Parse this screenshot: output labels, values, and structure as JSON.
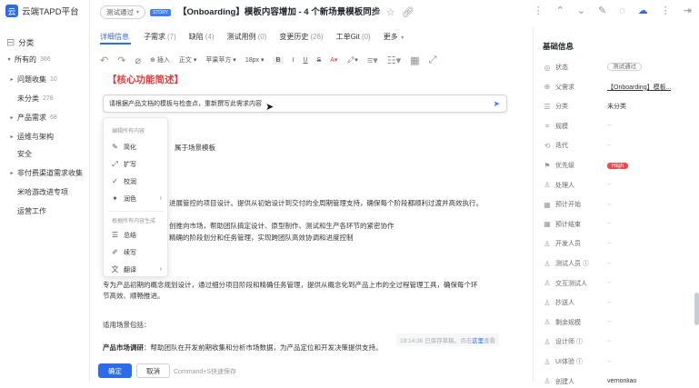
{
  "app": {
    "logo_char": "云",
    "name": "云端TAPD平台"
  },
  "sidebar": {
    "category_title": "分类",
    "items": [
      {
        "label": "所有的",
        "count": "366",
        "arrow": "▾"
      },
      {
        "label": "问题收集",
        "count": "10",
        "arrow": "▸"
      },
      {
        "label": "未分类",
        "count": "278",
        "arrow": ""
      },
      {
        "label": "产品需求",
        "count": "68",
        "arrow": "▸"
      },
      {
        "label": "运维与架构",
        "count": "",
        "arrow": "▸"
      },
      {
        "label": "安全",
        "count": "",
        "arrow": ""
      },
      {
        "label": "非付费渠道需求收集",
        "count": "",
        "arrow": "▸"
      },
      {
        "label": "米哈游改进专项",
        "count": "",
        "arrow": ""
      },
      {
        "label": "运营工作",
        "count": "",
        "arrow": ""
      }
    ]
  },
  "header": {
    "status": "测试通过",
    "badge": "STORY",
    "title": "【Onboarding】模板内容增加 - 4 个新场景模板同步"
  },
  "tabs": [
    {
      "label": "详细信息",
      "count": ""
    },
    {
      "label": "子需求",
      "count": "(7)"
    },
    {
      "label": "缺陷",
      "count": "(4)"
    },
    {
      "label": "测试用例",
      "count": "(0)"
    },
    {
      "label": "变更历史",
      "count": "(26)"
    },
    {
      "label": "工单Git",
      "count": "(0)"
    },
    {
      "label": "更多",
      "count": ""
    }
  ],
  "toolbar": {
    "insert": "插入",
    "text_style": "正文",
    "font": "苹果苹方",
    "size": "18px"
  },
  "editor": {
    "section_heading": "【核心功能简述】",
    "ai_prompt": "请根据产品文档的模板与检查点，重新撰写此需求内容",
    "line1": "属于场景模板",
    "line2": "进展管控的项目设计。提供从初始设计到交付的全周期管理支持，确保每个阶段都顺利过渡并高效执行。",
    "line3": "创推向市场，帮助团队搞定设计、原型制作、测试和生产各环节的紧密协作",
    "line4": "精确的阶段划分和任务管理，实现跨团队高效协调和进度控制",
    "line5": "专为产品初期的概念规划设计，通过细分项目阶段和精确任务管理，提供从概念化到产品上市的全过程管理工具，确保每个环",
    "line6": "节高效、顺畅推进。",
    "line7": "适用场景包括：",
    "line8_bold": "产品市场调研",
    "line8": "：帮助团队在开发前期收集和分析市场数据，为产品定位和开发决策提供支持。"
  },
  "ai_menu": {
    "group1": "编辑所有内容",
    "group2": "根据所有内容生成",
    "items1": [
      {
        "icon": "✎",
        "label": "简化",
        "sub": false
      },
      {
        "icon": "⤢",
        "label": "扩写",
        "sub": false
      },
      {
        "icon": "✓",
        "label": "校润",
        "sub": false
      },
      {
        "icon": "✦",
        "label": "润色",
        "sub": true
      }
    ],
    "items2": [
      {
        "icon": "☰",
        "label": "总结",
        "sub": false
      },
      {
        "icon": "✐",
        "label": "续写",
        "sub": false
      },
      {
        "icon": "文",
        "label": "翻译",
        "sub": true
      }
    ]
  },
  "footer": {
    "saved_time": "19:14:36 已保存草稿，点击",
    "saved_link": "这里",
    "saved_tail": "查看",
    "confirm": "确定",
    "cancel": "取消",
    "shortcut": "Command+S快速保存"
  },
  "panel": {
    "title": "基础信息",
    "props": [
      {
        "icon": "◎",
        "label": "状态",
        "value": "测试通过",
        "style": "pill-gray"
      },
      {
        "icon": "⊕",
        "label": "父需求",
        "value": "【Onboarding】模板...",
        "style": "link-u"
      },
      {
        "icon": "☰",
        "label": "分类",
        "value": "未分类",
        "style": ""
      },
      {
        "icon": "⌗",
        "label": "规模",
        "value": "--",
        "style": "empty"
      },
      {
        "icon": "⟲",
        "label": "迭代",
        "value": "--",
        "style": "empty"
      },
      {
        "icon": "⚑",
        "label": "优先级",
        "value": "High",
        "style": "pill-red"
      },
      {
        "icon": "♙",
        "label": "处理人",
        "value": "--",
        "style": "empty"
      },
      {
        "icon": "▦",
        "label": "预计开始",
        "value": "--",
        "style": "empty"
      },
      {
        "icon": "▦",
        "label": "预计结束",
        "value": "--",
        "style": "empty"
      },
      {
        "icon": "♙",
        "label": "开发人员",
        "value": "--",
        "style": "empty"
      },
      {
        "icon": "♙",
        "label": "测试人员 ⓘ",
        "value": "--",
        "style": "empty"
      },
      {
        "icon": "♙",
        "label": "交互测试人",
        "value": "--",
        "style": "empty"
      },
      {
        "icon": "♙",
        "label": "抄送人",
        "value": "--",
        "style": "empty"
      },
      {
        "icon": "♙",
        "label": "剩余规模",
        "value": "--",
        "style": "empty"
      },
      {
        "icon": "♙",
        "label": "设计师 ⓘ",
        "value": "--",
        "style": "empty"
      },
      {
        "icon": "♙",
        "label": "UI体验 ⓘ",
        "value": "--",
        "style": "empty"
      },
      {
        "icon": "♙",
        "label": "创建人",
        "value": "vernonliao",
        "style": ""
      }
    ]
  }
}
